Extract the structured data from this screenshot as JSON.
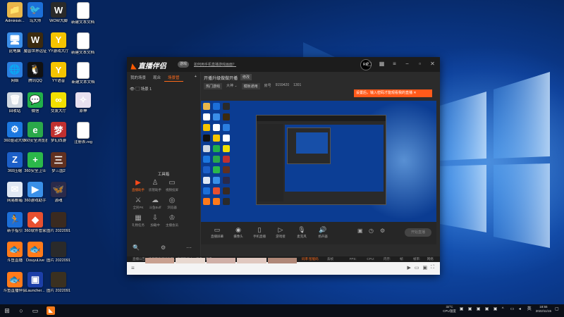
{
  "desktop": {
    "icons": [
      {
        "label": "Administr...",
        "color": "#e8b64a",
        "glyph": "📁",
        "icon": "folder-icon"
      },
      {
        "label": "鸟大师",
        "color": "#1c6fd8",
        "glyph": "🐦",
        "icon": "app-icon"
      },
      {
        "label": "WOW大脚",
        "color": "#2a2a2a",
        "glyph": "W",
        "icon": "wow-icon"
      },
      {
        "label": "新建文本文档 (2)",
        "color": "#ffffff",
        "glyph": "",
        "icon": "text-file-icon"
      },
      {
        "label": "此电脑",
        "color": "#3a8ee8",
        "glyph": "🖥",
        "icon": "computer-icon"
      },
      {
        "label": "魔兽世界远征",
        "color": "#3b2a10",
        "glyph": "W",
        "icon": "wow-icon"
      },
      {
        "label": "YY游戏大厅",
        "color": "#f5c400",
        "glyph": "Y",
        "icon": "yy-icon"
      },
      {
        "label": "新建文本文档 (3)",
        "color": "#ffffff",
        "glyph": "",
        "icon": "text-file-icon"
      },
      {
        "label": "网络",
        "color": "#2b7fe0",
        "glyph": "🌐",
        "icon": "network-icon"
      },
      {
        "label": "腾讯QQ",
        "color": "#111111",
        "glyph": "🐧",
        "icon": "qq-icon"
      },
      {
        "label": "YY语音",
        "color": "#f5c400",
        "glyph": "Y",
        "icon": "yy-icon"
      },
      {
        "label": "新建文本文档",
        "color": "#ffffff",
        "glyph": "",
        "icon": "text-file-icon"
      },
      {
        "label": "回收站",
        "color": "#cfd8e2",
        "glyph": "🗑",
        "icon": "recycle-bin-icon"
      },
      {
        "label": "微信",
        "color": "#22b04a",
        "glyph": "💬",
        "icon": "wechat-icon"
      },
      {
        "label": "交友大厅",
        "color": "#f2e000",
        "glyph": "∞",
        "icon": "app-icon"
      },
      {
        "label": "原神",
        "color": "#e8e0f0",
        "glyph": "✧",
        "icon": "genshin-icon"
      },
      {
        "label": "360驱动大师",
        "color": "#1c78e0",
        "glyph": "⚙",
        "icon": "app-icon"
      },
      {
        "label": "360安全浏览器",
        "color": "#2aa84a",
        "glyph": "e",
        "icon": "browser-icon"
      },
      {
        "label": "梦幻西游",
        "color": "#c03030",
        "glyph": "梦",
        "icon": "game-icon"
      },
      {
        "label": "注册表.reg",
        "color": "#ffffff",
        "glyph": "",
        "icon": "reg-file-icon"
      },
      {
        "label": "360压缩",
        "color": "#1c5fc8",
        "glyph": "Z",
        "icon": "zip-icon"
      },
      {
        "label": "360安全卫士",
        "color": "#2bb84a",
        "glyph": "+",
        "icon": "security-icon"
      },
      {
        "label": "梦三国2",
        "color": "#603020",
        "glyph": "三",
        "icon": "game-icon"
      },
      {
        "label": "",
        "color": "transparent",
        "glyph": "",
        "icon": ""
      },
      {
        "label": "网易邮箱",
        "color": "#e0e8f4",
        "glyph": "✉",
        "icon": "mail-icon"
      },
      {
        "label": "360游戏助手",
        "color": "#3a90e8",
        "glyph": "▶",
        "icon": "app-icon"
      },
      {
        "label": "源魂",
        "color": "#2a2a4a",
        "glyph": "🦋",
        "icon": "butterfly-icon"
      },
      {
        "label": "",
        "color": "transparent",
        "glyph": "",
        "icon": ""
      },
      {
        "label": "新手指引",
        "color": "#1c6fd8",
        "glyph": "🏃",
        "icon": "app-icon"
      },
      {
        "label": "360软件管家",
        "color": "#e85030",
        "glyph": "◆",
        "icon": "app-icon"
      },
      {
        "label": "图片 2022091...",
        "color": "#3a2a20",
        "glyph": "",
        "icon": "image-file-icon"
      },
      {
        "label": "",
        "color": "transparent",
        "glyph": "",
        "icon": ""
      },
      {
        "label": "斗鱼直播",
        "color": "#ff7a1a",
        "glyph": "🐟",
        "icon": "douyu-icon"
      },
      {
        "label": "DouyuLive",
        "color": "#ff7a1a",
        "glyph": "🐟",
        "icon": "douyu-icon"
      },
      {
        "label": "图片 2022091...",
        "color": "#2a2a2a",
        "glyph": "",
        "icon": "image-file-icon"
      },
      {
        "label": "",
        "color": "transparent",
        "glyph": "",
        "icon": ""
      },
      {
        "label": "斗鱼直播伴侣",
        "color": "#ff7a1a",
        "glyph": "🐟",
        "icon": "douyu-icon"
      },
      {
        "label": "Launcher...",
        "color": "#1c3fa8",
        "glyph": "▣",
        "icon": "launcher-icon"
      },
      {
        "label": "图片 2022091...",
        "color": "#3a3020",
        "glyph": "",
        "icon": "image-file-icon"
      }
    ]
  },
  "app": {
    "logo_text": "直播伴侣",
    "pill": "游戏",
    "notice": "如何用手机直播游戏画面？",
    "avatar_text": "RiP",
    "left_tabs": [
      "我的场景",
      "观众",
      "场景管"
    ],
    "scene_label": "场景 1",
    "toolbox_title": "工具箱",
    "tools": [
      {
        "name": "直播助手",
        "glyph": "▶",
        "hot": true
      },
      {
        "name": "房管助手",
        "glyph": "♙",
        "hot": false
      },
      {
        "name": "视频投屏",
        "glyph": "▭",
        "hot": false
      },
      {
        "name": "",
        "glyph": "",
        "hot": false
      },
      {
        "name": "全民PK",
        "glyph": "⚔",
        "hot": false
      },
      {
        "name": "斗鱼Buff",
        "glyph": "☁",
        "hot": false
      },
      {
        "name": "浏览器",
        "glyph": "◎",
        "hot": false
      },
      {
        "name": "",
        "glyph": "",
        "hot": false
      },
      {
        "name": "礼物任务",
        "glyph": "▦",
        "hot": false
      },
      {
        "name": "加载中",
        "glyph": "⇩",
        "hot": false
      },
      {
        "name": "主播会员",
        "glyph": "♔",
        "hot": false
      },
      {
        "name": "",
        "glyph": "",
        "hot": false
      }
    ],
    "room_title": "开播升级做做开播",
    "room_tag": "修改",
    "meta": [
      "热门游戏",
      "大神 ⌄",
      "模板通用",
      "房号",
      "9159420",
      "1301"
    ],
    "tip": "设置后，输入密码才能观看我的直播 ✕",
    "bottom_controls": [
      "直播屏幕",
      "摄像头",
      "手机直播",
      "游戏接",
      "麦克风",
      "扬声器"
    ],
    "start_live": "开始直播",
    "status_left": "直播公告：请勿在直播间发布，直播暂停中，更多一场播",
    "status_right": [
      "码率:智能码率 ⌄",
      "丢帧 0(0.00%)",
      "FPS: 0.00",
      "CPU: 0%",
      "内存: 0%",
      "帧: 0/0",
      "帧率: 0",
      "网络 0Kb/s"
    ],
    "status_highlight": "码率:智能码率 ⌄"
  },
  "taskbar": {
    "weather_temp": "32°C",
    "weather_desc": "CPU温度",
    "time": "18:55",
    "date": "2022/11/15"
  }
}
